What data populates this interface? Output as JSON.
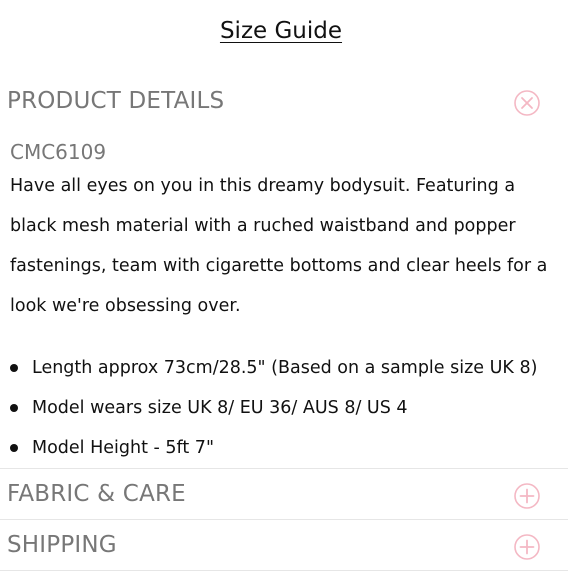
{
  "size_guide_label": "Size Guide",
  "sections": {
    "product_details": {
      "title": "PRODUCT DETAILS",
      "icon": "close-circle-icon",
      "sku": "CMC6109",
      "description": "Have all eyes on you in this dreamy bodysuit. Featuring a black mesh material with a ruched waistband and popper fastenings, team with cigarette bottoms and clear heels for a look we're obsessing over.",
      "bullets": [
        "Length approx 73cm/28.5\" (Based on a sample size UK 8)",
        "Model wears size UK 8/ EU 36/ AUS 8/ US 4",
        "Model Height - 5ft 7\""
      ]
    },
    "fabric_care": {
      "title": "FABRIC & CARE",
      "icon": "plus-circle-icon"
    },
    "shipping": {
      "title": "SHIPPING",
      "icon": "plus-circle-icon"
    }
  },
  "colors": {
    "accent": "#f4b8c4",
    "section_title": "#777777",
    "text": "#111111",
    "divider": "#e6e6e6"
  }
}
